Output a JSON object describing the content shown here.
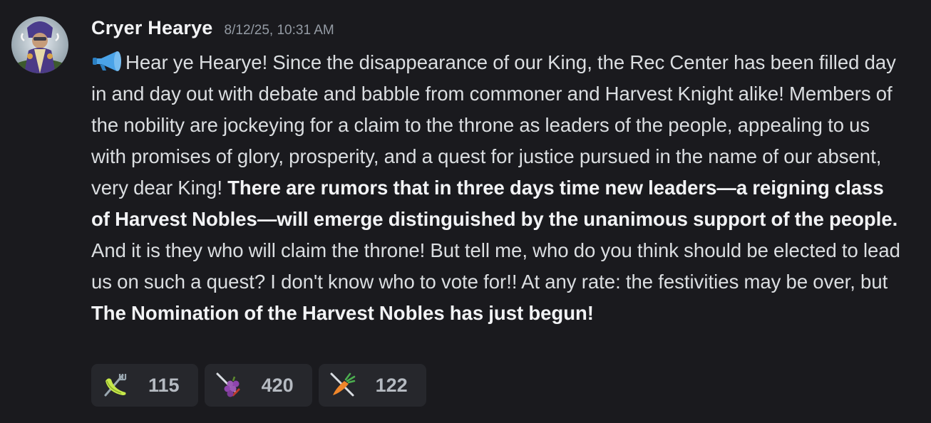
{
  "message": {
    "author": "Cryer Hearye",
    "timestamp": "8/12/25, 10:31 AM",
    "segments": [
      {
        "text": "Hear ye Hearye! Since the disappearance of our King, the Rec Center has been filled day in and day out with debate and babble from commoner and Harvest Knight alike! Members of the nobility are jockeying for a claim to the throne as leaders of the people, appealing to us with promises of glory, prosperity, and a quest for justice pursued in the name of our absent, very dear King! ",
        "bold": false
      },
      {
        "text": "There are rumors that in three days time new leaders—a reigning class of Harvest Nobles—will emerge distinguished by the unanimous support of the people.",
        "bold": true
      },
      {
        "text": " And it is they who will claim the throne! But tell me, who do you think should be elected to lead us on such a quest? I don't know who to vote for!! At any rate: the festivities may be over, but ",
        "bold": false
      },
      {
        "text": "The Nomination of the Harvest Nobles has just begun!",
        "bold": true
      }
    ],
    "leading_icon": "megaphone-icon"
  },
  "reactions": [
    {
      "icon": "banana-fork-icon",
      "count": "115"
    },
    {
      "icon": "grapes-sword-icon",
      "count": "420"
    },
    {
      "icon": "carrot-sword-icon",
      "count": "122"
    }
  ],
  "colors": {
    "background": "#1a1a1e",
    "text": "#dbdee1",
    "username": "#f2f3f5",
    "timestamp": "#949ba4",
    "reaction_bg": "#26272c"
  }
}
